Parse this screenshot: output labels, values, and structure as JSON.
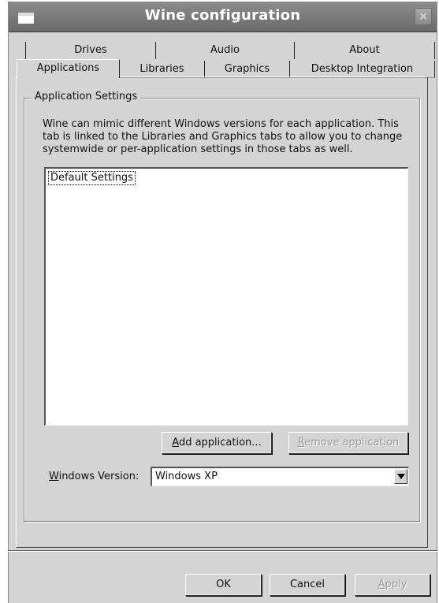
{
  "window": {
    "title": "Wine configuration",
    "close_glyph": "×"
  },
  "tabs": {
    "back_row": [
      "Drives",
      "Audio",
      "About"
    ],
    "front_row": [
      "Applications",
      "Libraries",
      "Graphics",
      "Desktop Integration"
    ],
    "active": "Applications"
  },
  "panel": {
    "group_title": "Application Settings",
    "description": "Wine can mimic different Windows versions for each application.  This\ntab is linked to the Libraries and Graphics tabs to allow you to change\nsystemwide or per-application settings in those tabs as well.",
    "app_list": [
      "Default Settings"
    ],
    "add_button": {
      "mnemonic": "A",
      "rest": "dd application..."
    },
    "remove_button": {
      "mnemonic": "R",
      "rest": "emove application"
    },
    "version_label": {
      "mnemonic": "W",
      "rest": "indows Version:"
    },
    "version_value": "Windows XP"
  },
  "footer": {
    "ok": "OK",
    "cancel": "Cancel",
    "apply": {
      "mnemonic": "A",
      "rest": "pply"
    }
  }
}
